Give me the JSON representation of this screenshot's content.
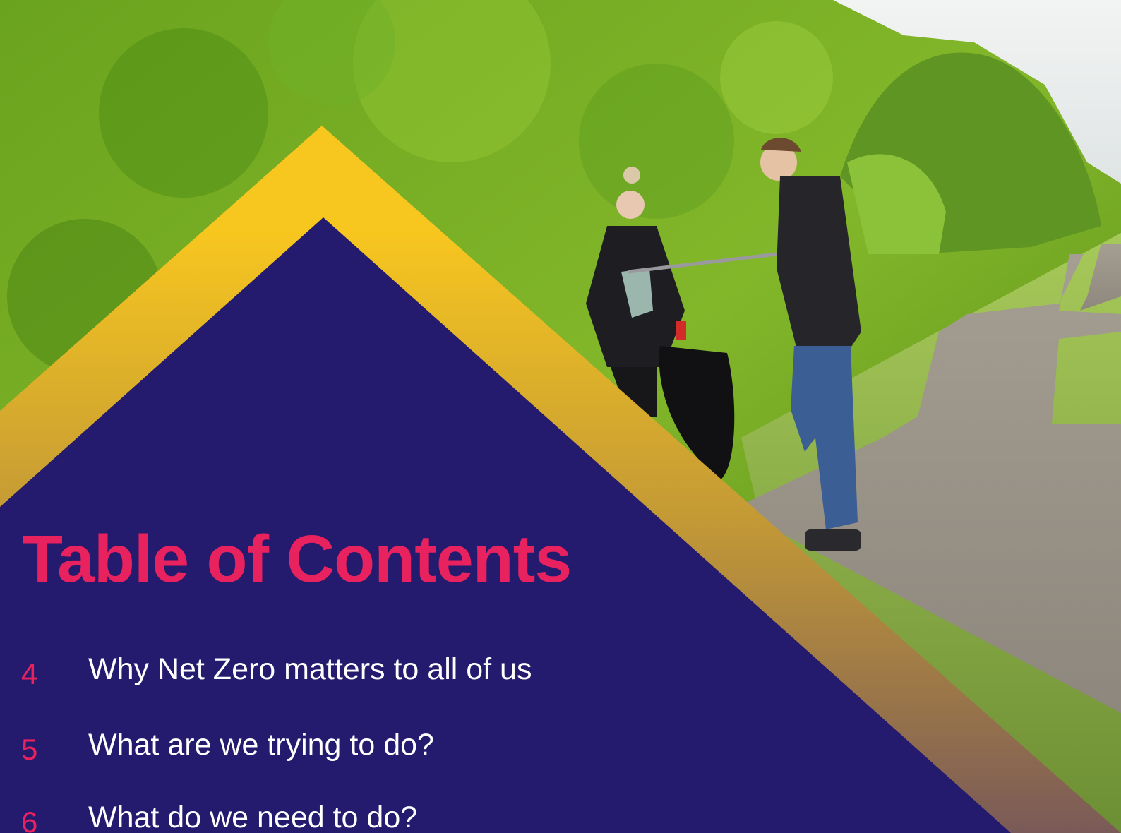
{
  "colors": {
    "navy": "#251B6E",
    "gold_top": "#F7C61F",
    "gold_bottom": "#7A5A58",
    "accent_pink": "#E8215F",
    "text_white": "#FFFFFF"
  },
  "photo": {
    "subject": "volunteers litter-picking beside a hedge-lined footpath",
    "icon": "photo-background"
  },
  "toc": {
    "title": "Table of Contents",
    "items": [
      {
        "page": "4",
        "label": "Why Net Zero matters to all of us"
      },
      {
        "page": "5",
        "label": "What are we trying to do?"
      },
      {
        "page": "6",
        "label": "What do we need to do?"
      }
    ]
  }
}
